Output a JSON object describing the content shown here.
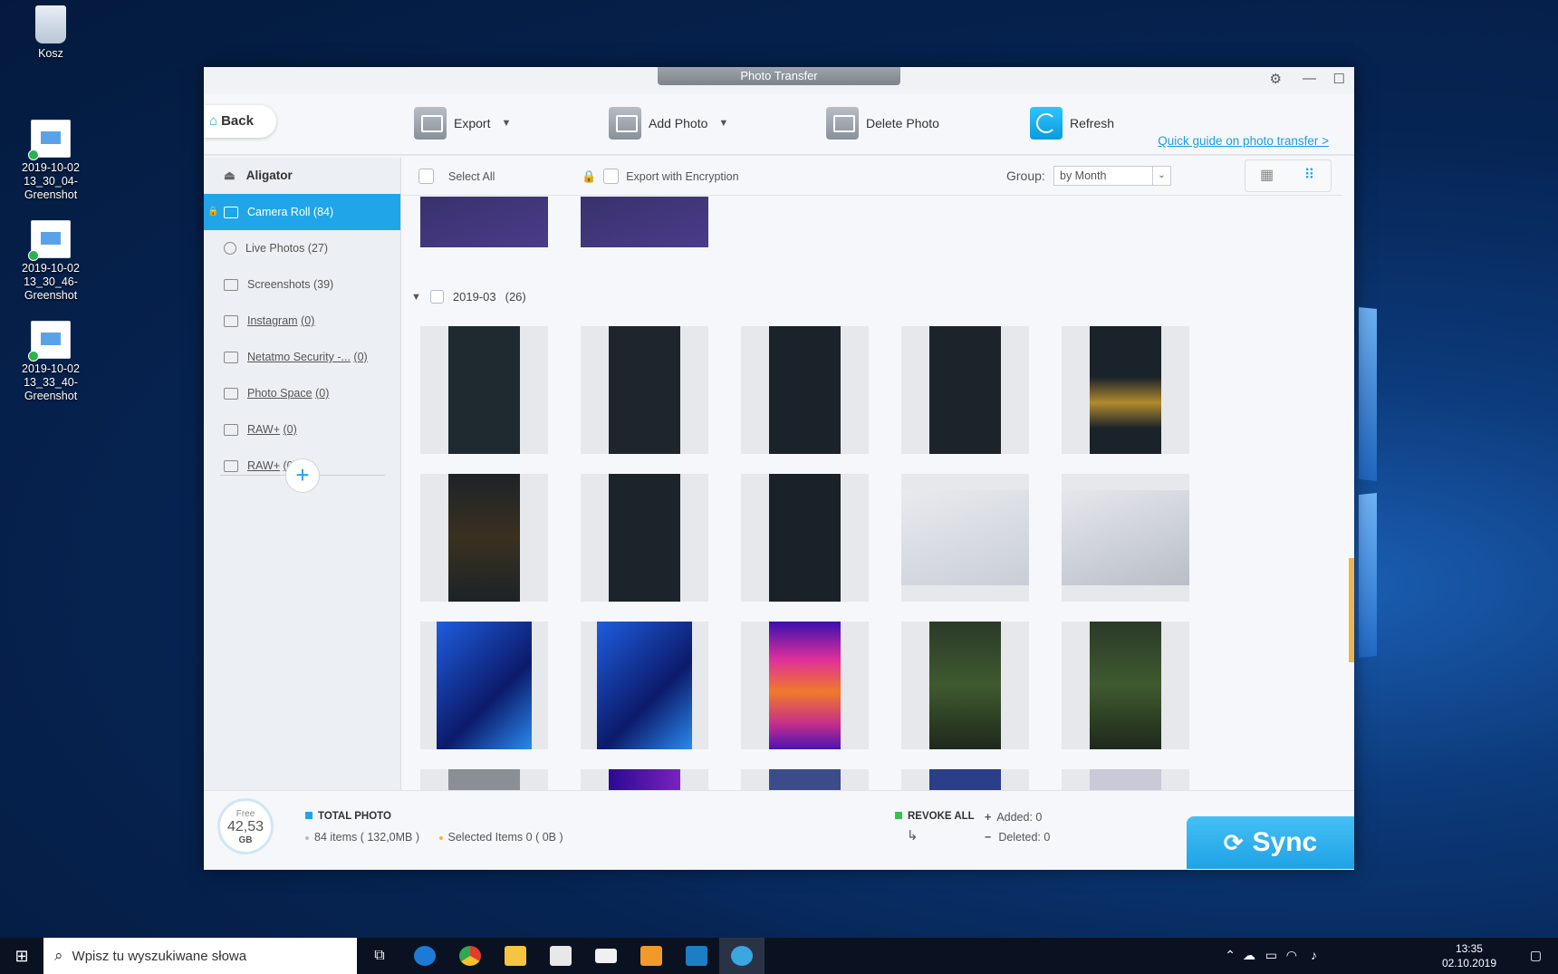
{
  "desktop": {
    "icons": [
      {
        "label": "Kosz"
      },
      {
        "label": "2019-10-02 13_30_04-Greenshot"
      },
      {
        "label": "2019-10-02 13_30_46-Greenshot"
      },
      {
        "label": "2019-10-02 13_33_40-Greenshot"
      }
    ]
  },
  "window": {
    "title": "Photo Transfer"
  },
  "toolbar": {
    "back_label": "Back",
    "export_label": "Export",
    "add_photo_label": "Add Photo",
    "delete_photo_label": "Delete Photo",
    "refresh_label": "Refresh",
    "guide_link": "Quick guide on photo transfer >"
  },
  "sidebar": {
    "device_name": "Aligator",
    "items": [
      {
        "label": "Camera Roll (84)",
        "active": true
      },
      {
        "label": "Live Photos (27)"
      },
      {
        "label": "Screenshots (39)"
      },
      {
        "label": "Instagram",
        "count": "(0)"
      },
      {
        "label": "Netatmo Security -...",
        "count": "(0)"
      },
      {
        "label": "Photo Space",
        "count": "(0)"
      },
      {
        "label": "RAW+",
        "count": "(0)"
      },
      {
        "label": "RAW+",
        "count": "(0)"
      }
    ],
    "add_symbol": "+"
  },
  "options": {
    "select_all": "Select All",
    "export_encryption": "Export with Encryption",
    "group_label": "Group:",
    "group_value": "by Month"
  },
  "gallery": {
    "group_title": "2019-03",
    "group_count": "(26)"
  },
  "status": {
    "free_label": "Free",
    "free_value": "42,53",
    "free_unit": "GB",
    "total_label": "TOTAL PHOTO",
    "items_text": "84 items ( 132,0MB )",
    "selected_text": "Selected Items 0 ( 0B )",
    "revoke_label": "REVOKE ALL",
    "added_text": "Added: 0",
    "deleted_text": "Deleted: 0",
    "sync_label": "Sync"
  },
  "taskbar": {
    "search_placeholder": "Wpisz tu wyszukiwane słowa",
    "time": "13:35",
    "date": "02.10.2019"
  },
  "colors": {
    "accent": "#20a6e8",
    "sync": "#1ea3e6",
    "revoke": "#3cc04c",
    "highlight": "#f0b54a"
  }
}
